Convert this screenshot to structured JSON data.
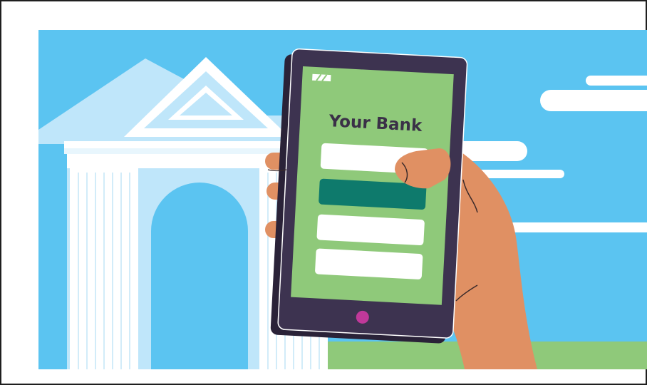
{
  "app": {
    "title": "Your Bank"
  },
  "colors": {
    "sky": "#5bc4f1",
    "building": "#bfe6fa",
    "building_white": "#ffffff",
    "grass": "#8fc97a",
    "phone_body": "#3d3350",
    "screen": "#8fc97a",
    "field": "#ffffff",
    "primary_button": "#0e7a6c",
    "home_button": "#c0399a",
    "skin": "#e09063",
    "skin_dark": "#3b2a2a"
  },
  "icons": {
    "battery": "battery-icon",
    "home": "home-button-icon"
  },
  "form": {
    "fields": [
      "field-1",
      "field-2",
      "field-3"
    ],
    "primary_action": "login-button"
  }
}
